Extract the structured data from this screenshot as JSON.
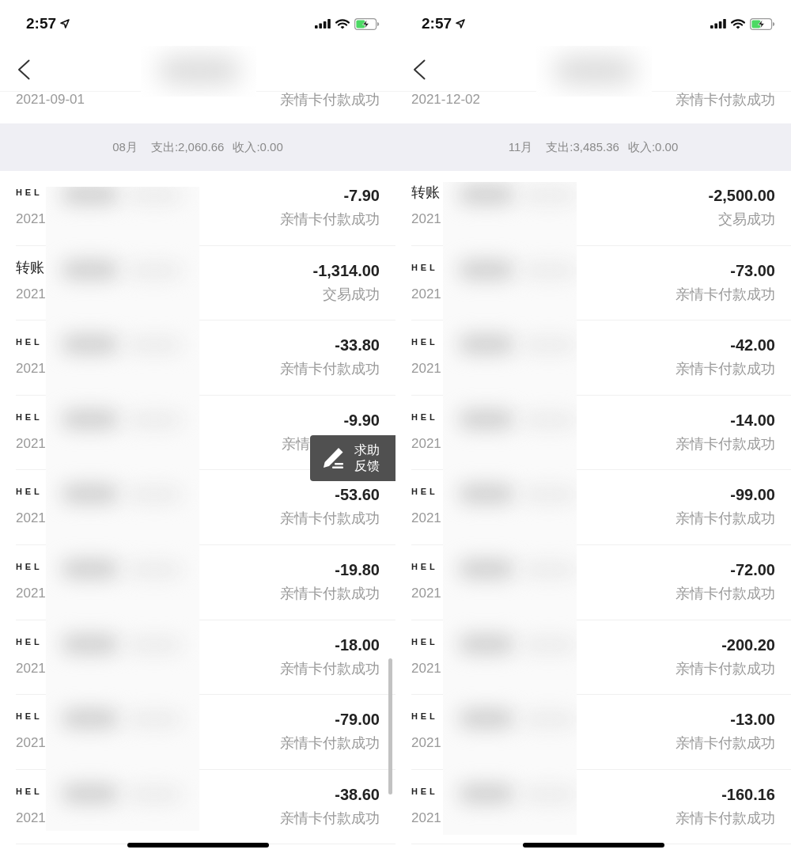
{
  "screens": [
    {
      "status_bar": {
        "time": "2:57"
      },
      "previous_row": {
        "date": "2021-09-01",
        "status": "亲情卡付款成功"
      },
      "month_summary": {
        "month": "08月",
        "expense": "支出:2,060.66",
        "income": "收入:0.00"
      },
      "transactions": [
        {
          "kind": "merchant",
          "title": "HEL",
          "date": "2021",
          "amount": "-7.90",
          "status": "亲情卡付款成功"
        },
        {
          "kind": "transfer",
          "title": "转账",
          "date": "2021",
          "amount": "-1,314.00",
          "status": "交易成功"
        },
        {
          "kind": "merchant",
          "title": "HEL",
          "date": "2021",
          "amount": "-33.80",
          "status": "亲情卡付款成功"
        },
        {
          "kind": "merchant",
          "title": "HEL",
          "date": "2021",
          "amount": "-9.90",
          "status": "亲情",
          "covered": true
        },
        {
          "kind": "merchant",
          "title": "HEL",
          "date": "2021",
          "amount": "-53.60",
          "status": "亲情卡付款成功"
        },
        {
          "kind": "merchant",
          "title": "HEL",
          "date": "2021",
          "amount": "-19.80",
          "status": "亲情卡付款成功"
        },
        {
          "kind": "merchant",
          "title": "HEL",
          "date": "2021",
          "amount": "-18.00",
          "status": "亲情卡付款成功"
        },
        {
          "kind": "merchant",
          "title": "HEL",
          "date": "2021",
          "amount": "-79.00",
          "status": "亲情卡付款成功"
        },
        {
          "kind": "merchant",
          "title": "HEL",
          "date": "2021",
          "amount": "-38.60",
          "status": "亲情卡付款成功"
        }
      ],
      "feedback_button": {
        "label": "求助反馈"
      },
      "scrollbar": true
    },
    {
      "status_bar": {
        "time": "2:57"
      },
      "previous_row": {
        "date": "2021-12-02",
        "status": "亲情卡付款成功"
      },
      "month_summary": {
        "month": "11月",
        "expense": "支出:3,485.36",
        "income": "收入:0.00"
      },
      "transactions": [
        {
          "kind": "transfer",
          "title": "转账",
          "date": "2021",
          "amount": "-2,500.00",
          "status": "交易成功"
        },
        {
          "kind": "merchant",
          "title": "HEL",
          "date": "2021",
          "amount": "-73.00",
          "status": "亲情卡付款成功"
        },
        {
          "kind": "merchant",
          "title": "HEL",
          "date": "2021",
          "amount": "-42.00",
          "status": "亲情卡付款成功"
        },
        {
          "kind": "merchant",
          "title": "HEL",
          "date": "2021",
          "amount": "-14.00",
          "status": "亲情卡付款成功"
        },
        {
          "kind": "merchant",
          "title": "HEL",
          "date": "2021",
          "amount": "-99.00",
          "status": "亲情卡付款成功"
        },
        {
          "kind": "merchant",
          "title": "HEL",
          "date": "2021",
          "amount": "-72.00",
          "status": "亲情卡付款成功"
        },
        {
          "kind": "merchant",
          "title": "HEL",
          "date": "2021",
          "amount": "-200.20",
          "status": "亲情卡付款成功"
        },
        {
          "kind": "merchant",
          "title": "HEL",
          "date": "2021",
          "amount": "-13.00",
          "status": "亲情卡付款成功"
        },
        {
          "kind": "merchant",
          "title": "HEL",
          "date": "2021",
          "amount": "-160.16",
          "status": "亲情卡付款成功"
        }
      ]
    }
  ]
}
